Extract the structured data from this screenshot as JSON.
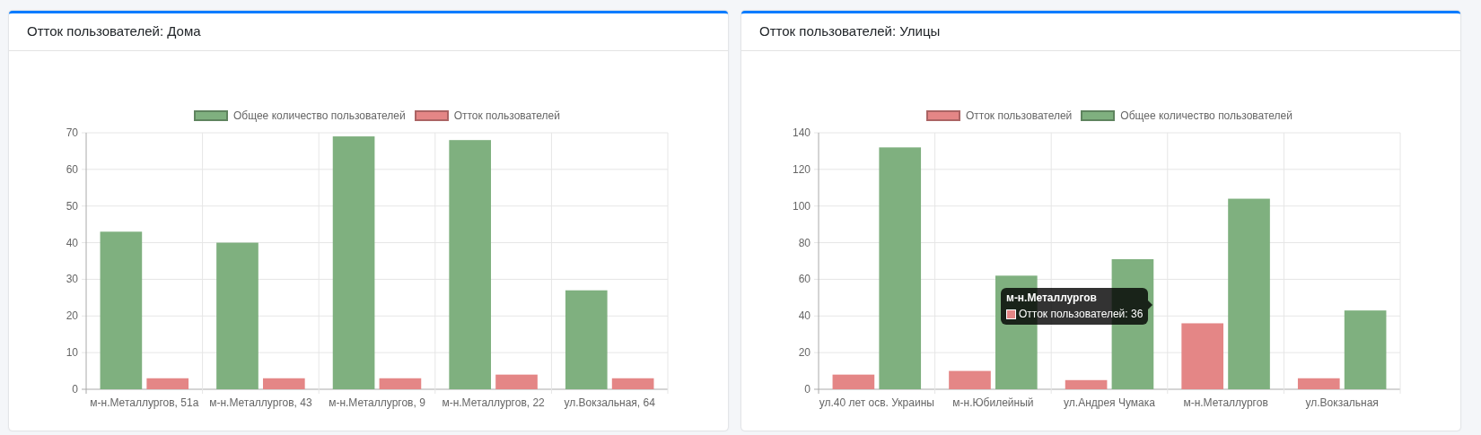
{
  "cards": [
    {
      "title": "Отток пользователей: Дома",
      "chart_data": {
        "type": "bar",
        "categories": [
          "м-н.Металлургов, 51а",
          "м-н.Металлургов, 43",
          "м-н.Металлургов, 9",
          "м-н.Металлургов, 22",
          "ул.Вокзальная, 64"
        ],
        "series": [
          {
            "name": "Общее количество пользователей",
            "color": "#7fb07f",
            "values": [
              43,
              40,
              69,
              68,
              27
            ]
          },
          {
            "name": "Отток пользователей",
            "color": "#e48686",
            "values": [
              3,
              3,
              3,
              4,
              3
            ]
          }
        ],
        "ylim": [
          0,
          70
        ],
        "yticks": [
          0,
          10,
          20,
          30,
          40,
          50,
          60,
          70
        ],
        "grid": true,
        "legend": true
      }
    },
    {
      "title": "Отток пользователей: Улицы",
      "chart_data": {
        "type": "bar",
        "categories": [
          "ул.40 лет осв. Украины",
          "м-н.Юбилейный",
          "ул.Андрея Чумака",
          "м-н.Металлургов",
          "ул.Вокзальная"
        ],
        "series": [
          {
            "name": "Отток пользователей",
            "color": "#e48686",
            "values": [
              8,
              10,
              5,
              36,
              6
            ]
          },
          {
            "name": "Общее количество пользователей",
            "color": "#7fb07f",
            "values": [
              132,
              62,
              71,
              104,
              43
            ]
          }
        ],
        "ylim": [
          0,
          140
        ],
        "yticks": [
          0,
          20,
          40,
          60,
          80,
          100,
          120,
          140
        ],
        "grid": true,
        "legend": true
      },
      "tooltip": {
        "title": "м-н.Металлургов",
        "label": "Отток пользователей: 36",
        "color": "#e48686"
      }
    }
  ]
}
